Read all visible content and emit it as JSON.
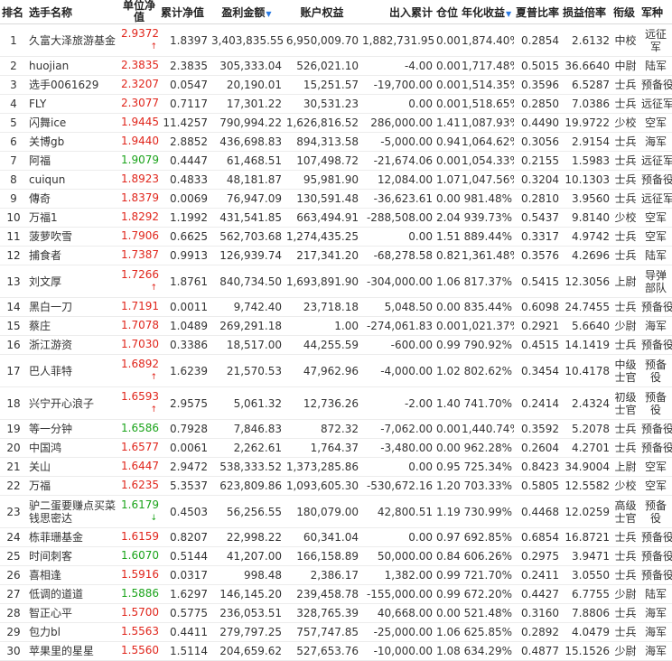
{
  "headers": {
    "rank": "排名",
    "name": "选手名称",
    "nav": "单位净值",
    "cum_nav": "累计净值",
    "pnl": "盈利金额",
    "equity": "账户权益",
    "outflow": "出入累计",
    "position": "仓位",
    "annual": "年化收益",
    "sharpe": "夏普比率",
    "ratio": "损益倍率",
    "grade": "衔级",
    "branch": "军种"
  },
  "rows": [
    {
      "rank": "1",
      "name": "久富大泽旅游基金",
      "nav": "2.9372",
      "dir": "up",
      "cum": "1.8397",
      "pnl": "3,403,835.55",
      "eq": "6,950,009.70",
      "out": "1,882,731.95",
      "pos": "0.00",
      "ann": "1,874.40%",
      "sh": "0.2854",
      "pl": "2.6132",
      "grade": "中校",
      "branch": "远征军",
      "tall": true
    },
    {
      "rank": "2",
      "name": "huojian",
      "nav": "2.3835",
      "dir": "up",
      "cum": "2.3835",
      "pnl": "305,333.04",
      "eq": "526,021.10",
      "out": "-4.00",
      "pos": "0.00",
      "ann": "1,717.48%",
      "sh": "0.5015",
      "pl": "36.6640",
      "grade": "中尉",
      "branch": "陆军"
    },
    {
      "rank": "3",
      "name": "选手0061629",
      "nav": "2.3207",
      "dir": "up",
      "cum": "0.0547",
      "pnl": "20,190.01",
      "eq": "15,251.57",
      "out": "-19,700.00",
      "pos": "0.00",
      "ann": "1,514.35%",
      "sh": "0.3596",
      "pl": "6.5287",
      "grade": "士兵",
      "branch": "预备役"
    },
    {
      "rank": "4",
      "name": "FLY",
      "nav": "2.3077",
      "dir": "up",
      "cum": "0.7117",
      "pnl": "17,301.22",
      "eq": "30,531.23",
      "out": "0.00",
      "pos": "0.00",
      "ann": "1,518.65%",
      "sh": "0.2850",
      "pl": "7.0386",
      "grade": "士兵",
      "branch": "远征军"
    },
    {
      "rank": "5",
      "name": "闪舞ice",
      "nav": "1.9445",
      "dir": "up",
      "cum": "11.4257",
      "pnl": "790,994.22",
      "eq": "1,626,816.52",
      "out": "286,000.00",
      "pos": "1.41",
      "ann": "1,087.93%",
      "sh": "0.4490",
      "pl": "19.9722",
      "grade": "少校",
      "branch": "空军"
    },
    {
      "rank": "6",
      "name": "关博gb",
      "nav": "1.9440",
      "dir": "up",
      "cum": "2.8852",
      "pnl": "436,698.83",
      "eq": "894,313.58",
      "out": "-5,000.00",
      "pos": "0.94",
      "ann": "1,064.62%",
      "sh": "0.3056",
      "pl": "2.9154",
      "grade": "士兵",
      "branch": "海军"
    },
    {
      "rank": "7",
      "name": "阿福",
      "nav": "1.9079",
      "dir": "down",
      "cum": "0.4447",
      "pnl": "61,468.51",
      "eq": "107,498.72",
      "out": "-21,674.06",
      "pos": "0.00",
      "ann": "1,054.33%",
      "sh": "0.2155",
      "pl": "1.5983",
      "grade": "士兵",
      "branch": "远征军"
    },
    {
      "rank": "8",
      "name": "cuiqun",
      "nav": "1.8923",
      "dir": "up",
      "cum": "0.4833",
      "pnl": "48,181.87",
      "eq": "95,981.90",
      "out": "12,084.00",
      "pos": "1.07",
      "ann": "1,047.56%",
      "sh": "0.3204",
      "pl": "10.1303",
      "grade": "士兵",
      "branch": "预备役"
    },
    {
      "rank": "9",
      "name": "傳奇",
      "nav": "1.8379",
      "dir": "up",
      "cum": "0.0069",
      "pnl": "76,947.09",
      "eq": "130,591.48",
      "out": "-36,623.61",
      "pos": "0.00",
      "ann": "981.48%",
      "sh": "0.2810",
      "pl": "3.9560",
      "grade": "士兵",
      "branch": "远征军"
    },
    {
      "rank": "10",
      "name": "万福1",
      "nav": "1.8292",
      "dir": "up",
      "cum": "1.1992",
      "pnl": "431,541.85",
      "eq": "663,494.91",
      "out": "-288,508.00",
      "pos": "2.04",
      "ann": "939.73%",
      "sh": "0.5437",
      "pl": "9.8140",
      "grade": "少校",
      "branch": "空军"
    },
    {
      "rank": "11",
      "name": "菠萝吹雪",
      "nav": "1.7906",
      "dir": "up",
      "cum": "0.6625",
      "pnl": "562,703.68",
      "eq": "1,274,435.25",
      "out": "0.00",
      "pos": "1.51",
      "ann": "889.44%",
      "sh": "0.3317",
      "pl": "4.9742",
      "grade": "士兵",
      "branch": "空军"
    },
    {
      "rank": "12",
      "name": "捕食者",
      "nav": "1.7387",
      "dir": "up",
      "cum": "0.9913",
      "pnl": "126,939.74",
      "eq": "217,341.20",
      "out": "-68,278.58",
      "pos": "0.82",
      "ann": "1,361.48%",
      "sh": "0.3576",
      "pl": "4.2696",
      "grade": "士兵",
      "branch": "陆军"
    },
    {
      "rank": "13",
      "name": "刘文厚",
      "nav": "1.7266",
      "dir": "up",
      "cum": "1.8761",
      "pnl": "840,734.50",
      "eq": "1,693,891.90",
      "out": "-304,000.00",
      "pos": "1.06",
      "ann": "817.37%",
      "sh": "0.5415",
      "pl": "12.3056",
      "grade": "上尉",
      "branch": "导弹部队",
      "tall": true
    },
    {
      "rank": "14",
      "name": "黑白一刀",
      "nav": "1.7191",
      "dir": "up",
      "cum": "0.0011",
      "pnl": "9,742.40",
      "eq": "23,718.18",
      "out": "5,048.50",
      "pos": "0.00",
      "ann": "835.44%",
      "sh": "0.6098",
      "pl": "24.7455",
      "grade": "士兵",
      "branch": "预备役"
    },
    {
      "rank": "15",
      "name": "蔡庄",
      "nav": "1.7078",
      "dir": "up",
      "cum": "1.0489",
      "pnl": "269,291.18",
      "eq": "1.00",
      "out": "-274,061.83",
      "pos": "0.00",
      "ann": "1,021.37%",
      "sh": "0.2921",
      "pl": "5.6640",
      "grade": "少尉",
      "branch": "海军"
    },
    {
      "rank": "16",
      "name": "浙江游资",
      "nav": "1.7030",
      "dir": "up",
      "cum": "0.3386",
      "pnl": "18,517.00",
      "eq": "44,255.59",
      "out": "-600.00",
      "pos": "0.99",
      "ann": "790.92%",
      "sh": "0.4515",
      "pl": "14.1419",
      "grade": "士兵",
      "branch": "预备役"
    },
    {
      "rank": "17",
      "name": "巴人菲特",
      "nav": "1.6892",
      "dir": "up",
      "cum": "1.6239",
      "pnl": "21,570.53",
      "eq": "47,962.96",
      "out": "-4,000.00",
      "pos": "1.02",
      "ann": "802.62%",
      "sh": "0.3454",
      "pl": "10.4178",
      "grade": "中级士官",
      "branch": "预备役",
      "tall": true
    },
    {
      "rank": "18",
      "name": "兴宁开心浪子",
      "nav": "1.6593",
      "dir": "up",
      "cum": "2.9575",
      "pnl": "5,061.32",
      "eq": "12,736.26",
      "out": "-2.00",
      "pos": "1.40",
      "ann": "741.70%",
      "sh": "0.2414",
      "pl": "2.4324",
      "grade": "初级士官",
      "branch": "预备役",
      "tall": true
    },
    {
      "rank": "19",
      "name": "等一分钟",
      "nav": "1.6586",
      "dir": "down",
      "cum": "0.7928",
      "pnl": "7,846.83",
      "eq": "872.32",
      "out": "-7,062.00",
      "pos": "0.00",
      "ann": "1,440.74%",
      "sh": "0.3592",
      "pl": "5.2078",
      "grade": "士兵",
      "branch": "预备役"
    },
    {
      "rank": "20",
      "name": "中国鸿",
      "nav": "1.6577",
      "dir": "up",
      "cum": "0.0061",
      "pnl": "2,262.61",
      "eq": "1,764.37",
      "out": "-3,480.00",
      "pos": "0.00",
      "ann": "962.28%",
      "sh": "0.2604",
      "pl": "4.2701",
      "grade": "士兵",
      "branch": "预备役"
    },
    {
      "rank": "21",
      "name": "关山",
      "nav": "1.6447",
      "dir": "up",
      "cum": "2.9472",
      "pnl": "538,333.52",
      "eq": "1,373,285.86",
      "out": "0.00",
      "pos": "0.95",
      "ann": "725.34%",
      "sh": "0.8423",
      "pl": "34.9004",
      "grade": "上尉",
      "branch": "空军"
    },
    {
      "rank": "22",
      "name": "万福",
      "nav": "1.6235",
      "dir": "up",
      "cum": "5.3537",
      "pnl": "623,809.86",
      "eq": "1,093,605.30",
      "out": "-530,672.16",
      "pos": "1.20",
      "ann": "703.33%",
      "sh": "0.5805",
      "pl": "12.5582",
      "grade": "少校",
      "branch": "空军"
    },
    {
      "rank": "23",
      "name": "驴二蛋要赚点买菜钱思密达",
      "nav": "1.6179",
      "dir": "down",
      "cum": "0.4503",
      "pnl": "56,256.55",
      "eq": "180,079.00",
      "out": "42,800.51",
      "pos": "1.19",
      "ann": "730.99%",
      "sh": "0.4468",
      "pl": "12.0259",
      "grade": "高级士官",
      "branch": "预备役",
      "tall": true
    },
    {
      "rank": "24",
      "name": "栋菲珊基金",
      "nav": "1.6159",
      "dir": "up",
      "cum": "0.8207",
      "pnl": "22,998.22",
      "eq": "60,341.04",
      "out": "0.00",
      "pos": "0.97",
      "ann": "692.85%",
      "sh": "0.6854",
      "pl": "16.8721",
      "grade": "士兵",
      "branch": "预备役"
    },
    {
      "rank": "25",
      "name": "时间刺客",
      "nav": "1.6070",
      "dir": "down",
      "cum": "0.5144",
      "pnl": "41,207.00",
      "eq": "166,158.89",
      "out": "50,000.00",
      "pos": "0.84",
      "ann": "606.26%",
      "sh": "0.2975",
      "pl": "3.9471",
      "grade": "士兵",
      "branch": "预备役"
    },
    {
      "rank": "26",
      "name": "喜相逢",
      "nav": "1.5916",
      "dir": "up",
      "cum": "0.0317",
      "pnl": "998.48",
      "eq": "2,386.17",
      "out": "1,382.00",
      "pos": "0.99",
      "ann": "721.70%",
      "sh": "0.2411",
      "pl": "3.0550",
      "grade": "士兵",
      "branch": "预备役"
    },
    {
      "rank": "27",
      "name": "低调的道道",
      "nav": "1.5886",
      "dir": "down",
      "cum": "1.6297",
      "pnl": "146,145.20",
      "eq": "239,458.78",
      "out": "-155,000.00",
      "pos": "0.99",
      "ann": "672.20%",
      "sh": "0.4427",
      "pl": "6.7755",
      "grade": "少尉",
      "branch": "陆军"
    },
    {
      "rank": "28",
      "name": "智正心平",
      "nav": "1.5700",
      "dir": "up",
      "cum": "0.5775",
      "pnl": "236,053.51",
      "eq": "328,765.39",
      "out": "40,668.00",
      "pos": "0.00",
      "ann": "521.48%",
      "sh": "0.3160",
      "pl": "7.8806",
      "grade": "士兵",
      "branch": "海军"
    },
    {
      "rank": "29",
      "name": "包力bl",
      "nav": "1.5563",
      "dir": "up",
      "cum": "0.4411",
      "pnl": "279,797.25",
      "eq": "757,747.85",
      "out": "-25,000.00",
      "pos": "1.06",
      "ann": "625.85%",
      "sh": "0.2892",
      "pl": "4.0479",
      "grade": "士兵",
      "branch": "海军"
    },
    {
      "rank": "30",
      "name": "苹果里的星星",
      "nav": "1.5560",
      "dir": "up",
      "cum": "1.5114",
      "pnl": "204,659.62",
      "eq": "527,653.76",
      "out": "-10,000.00",
      "pos": "1.08",
      "ann": "634.29%",
      "sh": "0.4877",
      "pl": "15.1526",
      "grade": "少尉",
      "branch": "海军"
    }
  ],
  "arrows": {
    "up": "↑",
    "down": "↓"
  },
  "colors": {
    "up": "#e0251b",
    "down": "#1aa31a",
    "sort": "#2a7ae2"
  }
}
